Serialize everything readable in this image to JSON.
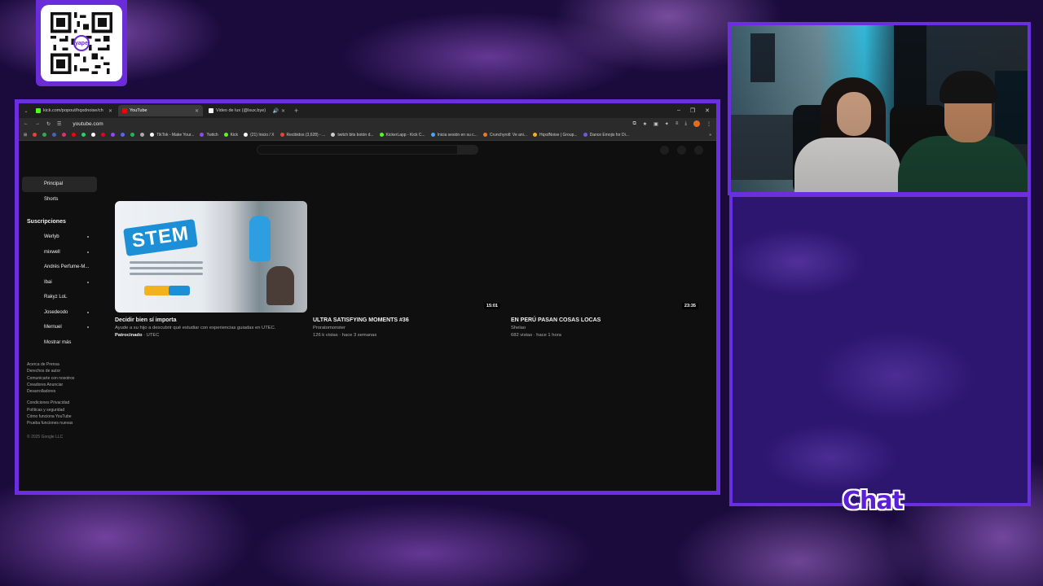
{
  "browser": {
    "tabs": [
      {
        "label": "kick.com/popout/hqxdnoise/ch",
        "color": "#53fc18",
        "active": false
      },
      {
        "label": "YouTube",
        "color": "#ff0000",
        "active": true
      },
      {
        "label": "Video de lux (@lsux.bye)",
        "color": "#ffffff",
        "active": false
      }
    ],
    "url": "youtube.com",
    "bookmarks": [
      {
        "label": "TikTok - Make Your...",
        "color": "#ffffff"
      },
      {
        "label": "Twitch",
        "color": "#9146ff"
      },
      {
        "label": "Kick",
        "color": "#53fc18"
      },
      {
        "label": "(21) Inicio / X",
        "color": "#ffffff"
      },
      {
        "label": "Recibidos (3,628) - ...",
        "color": "#ea4335"
      },
      {
        "label": "twitch bits botón d...",
        "color": "#cccccc"
      },
      {
        "label": "KickerLapp - Kick C...",
        "color": "#53fc18"
      },
      {
        "label": "Inicia sesión en su c...",
        "color": "#4aa3ff"
      },
      {
        "label": "Crunchyroll: Ve ani...",
        "color": "#f47521"
      },
      {
        "label": "HqxdNoise | Group...",
        "color": "#f2b21d"
      },
      {
        "label": "Dance Emojis for Di...",
        "color": "#6a5bd6"
      }
    ]
  },
  "youtube": {
    "sidebar": {
      "main": [
        "Principal",
        "Shorts"
      ],
      "subs_heading": "Suscripciones",
      "subs": [
        "Werlyb",
        "mixwell",
        "Andrés Perfume-M...",
        "Ibai",
        "Rakyz LoL",
        "Josedeodo",
        "Mernuel"
      ],
      "show_more": "Mostrar más",
      "footer1": [
        "Acerca de  Prensa",
        "Derechos de autor",
        "Comunicarte con nosotros",
        "Creadores  Anunciar",
        "Desarrolladores"
      ],
      "footer2": [
        "Condiciones  Privacidad",
        "Políticas y seguridad",
        "Cómo funciona YouTube",
        "Prueba funciones nuevas"
      ],
      "copyright": "© 2025 Google LLC"
    },
    "videos": [
      {
        "title": "Decidir bien sí importa",
        "line1": "Ayude a su hijo a descubrir qué estudiar con experiencias guiadas en UTEC.",
        "sponsored": "Patrocinado",
        "channel": "UTEC",
        "thumb_text": "STEM",
        "duration": ""
      },
      {
        "title": "ULTRA SATISFYING MOMENTS #36",
        "channel": "Proratomonster",
        "meta": "126 k vistas · hace 3 semanas",
        "duration": "15:01"
      },
      {
        "title": "EN PERÚ PASAN COSAS LOCAS",
        "channel": "Shelao",
        "meta": "682 vistas · hace 1 hora",
        "duration": "23:35"
      }
    ]
  },
  "overlay": {
    "chat_label": "Chat",
    "qr_logo": "yape"
  }
}
